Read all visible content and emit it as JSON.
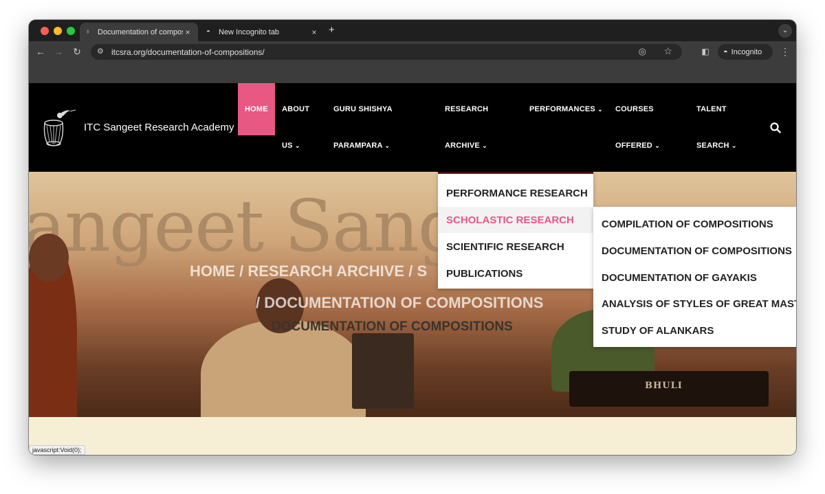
{
  "browser": {
    "tabs": [
      {
        "title": "Documentation of compositio",
        "icon": "tabla-favicon-icon",
        "close": "×"
      },
      {
        "title": "New Incognito tab",
        "icon": "incognito-icon",
        "close": "×"
      }
    ],
    "new_tab": "+",
    "url": "itcsra.org/documentation-of-compositions/",
    "profile_label": "Incognito",
    "status_text": "javascript:Void(0);"
  },
  "site": {
    "brand": "ITC Sangeet Research Academy",
    "nav": [
      {
        "line1": "HOME",
        "line2": "",
        "caret": false
      },
      {
        "line1": "ABOUT",
        "line2": "US",
        "caret": true
      },
      {
        "line1": "GURU SHISHYA",
        "line2": "PARAMPARA",
        "caret": true
      },
      {
        "line1": "RESEARCH",
        "line2": "ARCHIVE",
        "caret": true
      },
      {
        "line1": "PERFORMANCES",
        "line2": "",
        "caret": true
      },
      {
        "line1": "COURSES",
        "line2": "OFFERED",
        "caret": true
      },
      {
        "line1": "TALENT",
        "line2": "SEARCH",
        "caret": true
      }
    ],
    "caret_glyph": "⌄",
    "hero": {
      "bg_word": "angeet Sangeet",
      "breadcrumb_line1": "HOME / RESEARCH ARCHIVE / S",
      "breadcrumb_line2": "/ DOCUMENTATION OF COMPOSITIONS",
      "page_title": "DOCUMENTATION OF COMPOSITIONS",
      "harmonium_label": "BHULI"
    },
    "research_menu": [
      {
        "label": "PERFORMANCE RESEARCH",
        "highlighted": false
      },
      {
        "label": "SCHOLASTIC RESEARCH",
        "highlighted": true
      },
      {
        "label": "SCIENTIFIC RESEARCH",
        "highlighted": false
      },
      {
        "label": "PUBLICATIONS",
        "highlighted": false
      }
    ],
    "scholastic_submenu": [
      "COMPILATION OF COMPOSITIONS",
      "DOCUMENTATION OF COMPOSITIONS",
      "DOCUMENTATION OF GAYAKIS",
      "ANALYSIS OF STYLES OF GREAT MAST",
      "STUDY OF ALANKARS"
    ]
  },
  "colors": {
    "accent_pink": "#e95783",
    "header_black": "#000000",
    "dropdown_border": "#4a0e0e",
    "cream": "#f6efd6"
  }
}
